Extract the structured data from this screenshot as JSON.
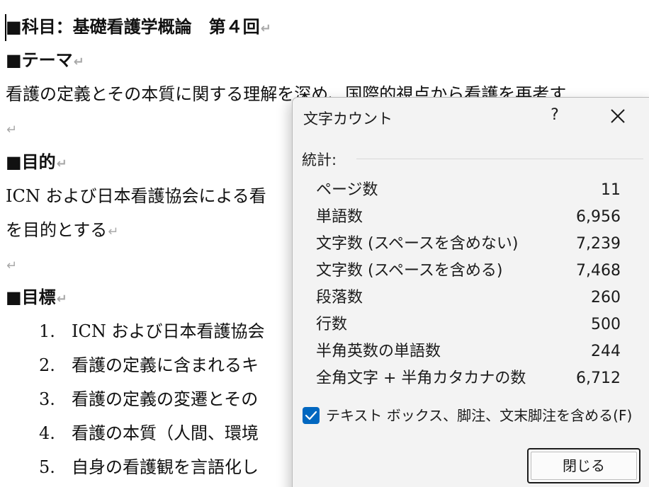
{
  "document": {
    "heading": "■科目：基礎看護学概論　第４回",
    "theme_heading": "■テーマ",
    "theme_text": "看護の定義とその本質に関する理解を深め、国際的視点から看護を再考す",
    "purpose_heading": "■目的",
    "purpose_line1": "ICN および日本看護協会による看",
    "purpose_line2": "を目的とする",
    "goals_heading": "■目標",
    "goals": [
      {
        "num": "1.",
        "text": "ICN および日本看護協会"
      },
      {
        "num": "2.",
        "text": "看護の定義に含まれるキ"
      },
      {
        "num": "3.",
        "text": "看護の定義の変遷とその"
      },
      {
        "num": "4.",
        "text": "看護の本質（人間、環境"
      },
      {
        "num": "5.",
        "text": "自身の看護観を言語化し"
      }
    ],
    "para_mark": "↵"
  },
  "dialog": {
    "title": "文字カウント",
    "help_icon": "?",
    "close_icon": "close-icon",
    "stats_label": "統計:",
    "stats": [
      {
        "label": "ページ数",
        "value": "11"
      },
      {
        "label": "単語数",
        "value": "6,956"
      },
      {
        "label": "文字数 (スペースを含めない)",
        "value": "7,239"
      },
      {
        "label": "文字数 (スペースを含める)",
        "value": "7,468"
      },
      {
        "label": "段落数",
        "value": "260"
      },
      {
        "label": "行数",
        "value": "500"
      },
      {
        "label": "半角英数の単語数",
        "value": "244"
      },
      {
        "label": "全角文字 + 半角カタカナの数",
        "value": "6,712"
      }
    ],
    "checkbox_label": "テキスト ボックス、脚注、文末脚注を含める(F)",
    "checkbox_checked": true,
    "close_button": "閉じる",
    "accent_color": "#0067c0"
  }
}
